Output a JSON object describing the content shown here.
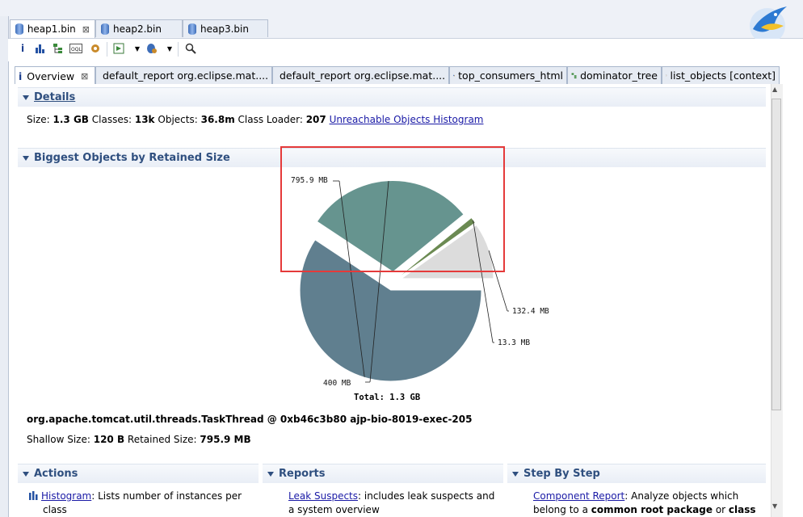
{
  "file_tabs": [
    {
      "label": "heap1.bin",
      "close": "⊠"
    },
    {
      "label": "heap2.bin"
    },
    {
      "label": "heap3.bin"
    }
  ],
  "editor_tabs": [
    {
      "label": "Overview",
      "close": "⊠"
    },
    {
      "label": "default_report  org.eclipse.mat...."
    },
    {
      "label": "default_report  org.eclipse.mat...."
    },
    {
      "label": "top_consumers_html"
    },
    {
      "label": "dominator_tree"
    },
    {
      "label": "list_objects [context]"
    }
  ],
  "details": {
    "header": "Details",
    "size_label": "Size:",
    "size_value": "1.3 GB",
    "classes_label": "Classes:",
    "classes_value": "13k",
    "objects_label": "Objects:",
    "objects_value": "36.8m",
    "loader_label": "Class Loader:",
    "loader_value": "207",
    "link": "Unreachable Objects Histogram"
  },
  "biggest": {
    "header": "Biggest Objects by Retained Size",
    "object_name": "org.apache.tomcat.util.threads.TaskThread @ 0xb46c3b80 ajp-bio-8019-exec-205",
    "shallow_label": "Shallow Size:",
    "shallow_value": "120 B",
    "retained_label": "Retained Size:",
    "retained_value": "795.9 MB"
  },
  "chart_data": {
    "type": "pie",
    "values": [
      795.9,
      400,
      13.3,
      132.4
    ],
    "labels": [
      "795.9 MB",
      "400 MB",
      "13.3 MB",
      "132.4 MB"
    ],
    "colors": [
      "#607f8f",
      "#66948f",
      "#6b8a52",
      "#dcdcdc"
    ],
    "total_label": "Total: 1.3 GB"
  },
  "actions": {
    "header": "Actions",
    "link": "Histogram",
    "text": ": Lists number of instances per",
    "text2": "class"
  },
  "reports": {
    "header": "Reports",
    "link": "Leak Suspects",
    "text": ": includes leak suspects and",
    "text2": "a system overview"
  },
  "stepbystep": {
    "header": "Step By Step",
    "link": "Component Report",
    "text": ": Analyze objects which",
    "text2a": "belong to a ",
    "text2b": "common root package",
    "text2c": " or ",
    "text2d": "class"
  },
  "colors": {
    "accent": "#2f4f7f",
    "link": "#1a1aa6",
    "highlight": "#e53a3a"
  }
}
